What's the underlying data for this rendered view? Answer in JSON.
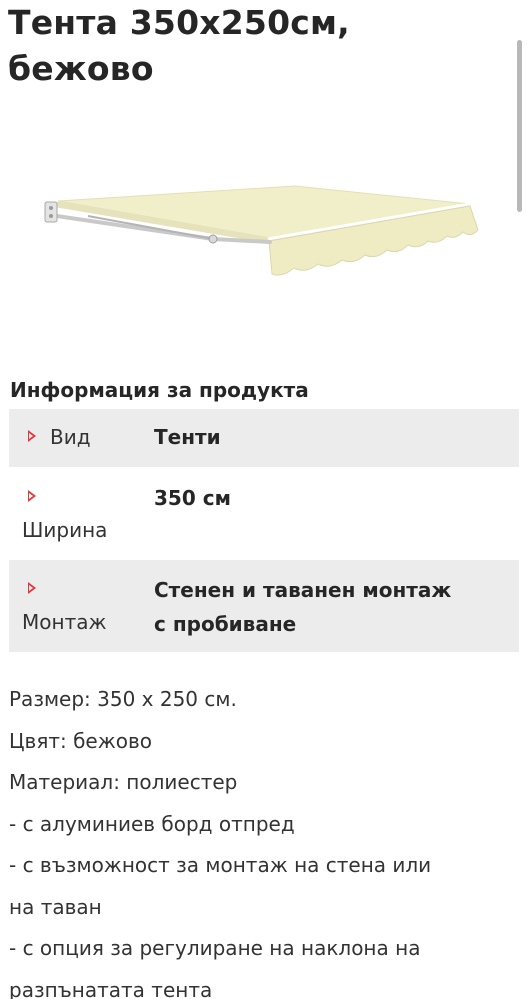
{
  "product": {
    "title": "Тента 350x250см,\nбежово",
    "image_alt": "Тента 350x250см, бежово"
  },
  "info": {
    "heading": "Информация за продукта",
    "rows": [
      {
        "label": "Вид",
        "value": "Тенти"
      },
      {
        "label": "Ширина",
        "value": "350 см"
      },
      {
        "label": "Монтаж",
        "value": "Стенен и таванен монтаж\nс пробиване"
      }
    ]
  },
  "description": {
    "lines": [
      "Размер: 350 x 250 см.",
      "Цвят: бежово",
      "Материал: полиестер",
      "- с алуминиев борд отпред",
      "- с възможност за монтаж на стена или",
      "на таван",
      "- с опция за регулиране на наклона на",
      "разпънатата тента"
    ]
  },
  "colors": {
    "fabric": "#f3f0c8",
    "accent_marker": "#e0393e",
    "row_shading": "#ececec"
  }
}
